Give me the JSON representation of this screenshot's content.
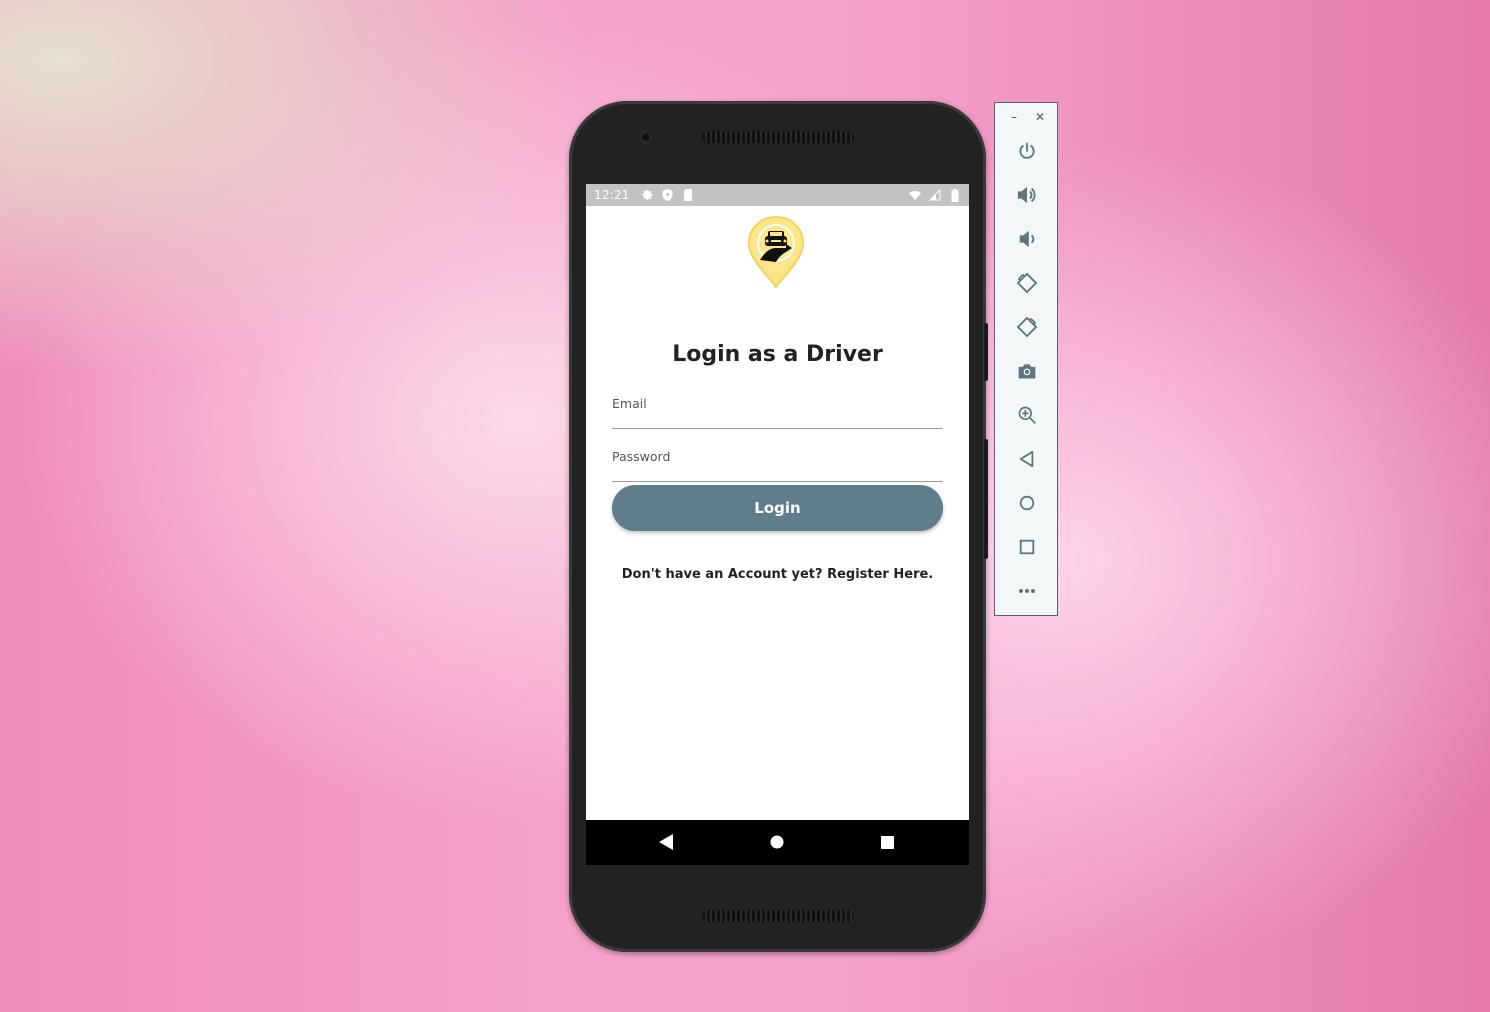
{
  "status_bar": {
    "time": "12:21"
  },
  "app": {
    "title": "Login as a Driver",
    "email_label": "Email",
    "password_label": "Password",
    "login_label": "Login",
    "register_text": "Don't have an Account yet? Register Here."
  },
  "colors": {
    "primary": "#607d8b",
    "logo_yellow": "#fde68a",
    "status_bar": "#c2c2c2"
  },
  "emulator_toolbar": {
    "window_controls": [
      "minimize-icon",
      "close-icon"
    ],
    "buttons": [
      "power-icon",
      "volume-up-icon",
      "volume-down-icon",
      "rotate-left-icon",
      "rotate-right-icon",
      "camera-icon",
      "zoom-icon",
      "back-icon",
      "home-icon",
      "overview-icon",
      "more-icon"
    ],
    "minimize_glyph": "–",
    "close_glyph": "✕"
  }
}
